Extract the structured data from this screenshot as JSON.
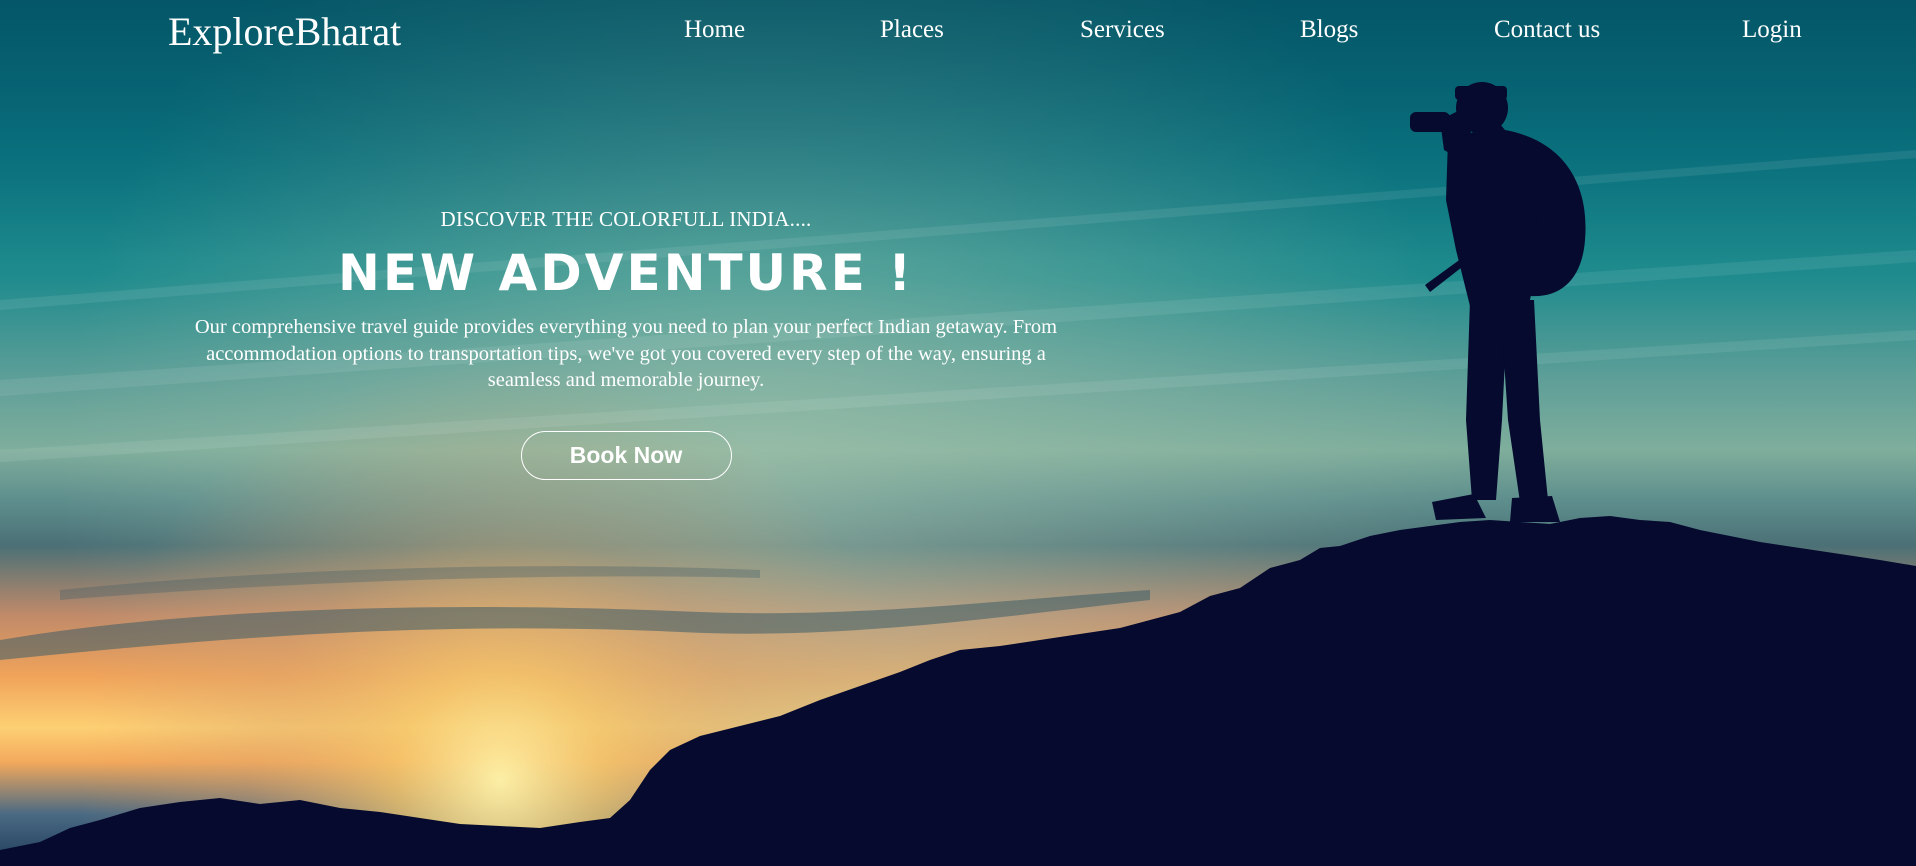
{
  "nav": {
    "brand": "ExploreBharat",
    "links": [
      {
        "label": "Home"
      },
      {
        "label": "Places"
      },
      {
        "label": "Services"
      },
      {
        "label": "Blogs"
      },
      {
        "label": "Contact us"
      },
      {
        "label": "Login"
      }
    ]
  },
  "hero": {
    "eyebrow": "DISCOVER THE COLORFULL INDIA....",
    "headline": "NEW ADVENTURE !",
    "description": "Our comprehensive travel guide provides everything you need to plan your perfect Indian getaway. From accommodation options to transportation tips, we've got you covered every step of the way, ensuring a seamless and memorable journey.",
    "cta_label": "Book Now"
  },
  "theme": {
    "sky_top": "#066878",
    "sky_mid": "#7fae9c",
    "sunset": "#fdd073",
    "silhouette": "#050a2e",
    "text": "#ffffff"
  }
}
